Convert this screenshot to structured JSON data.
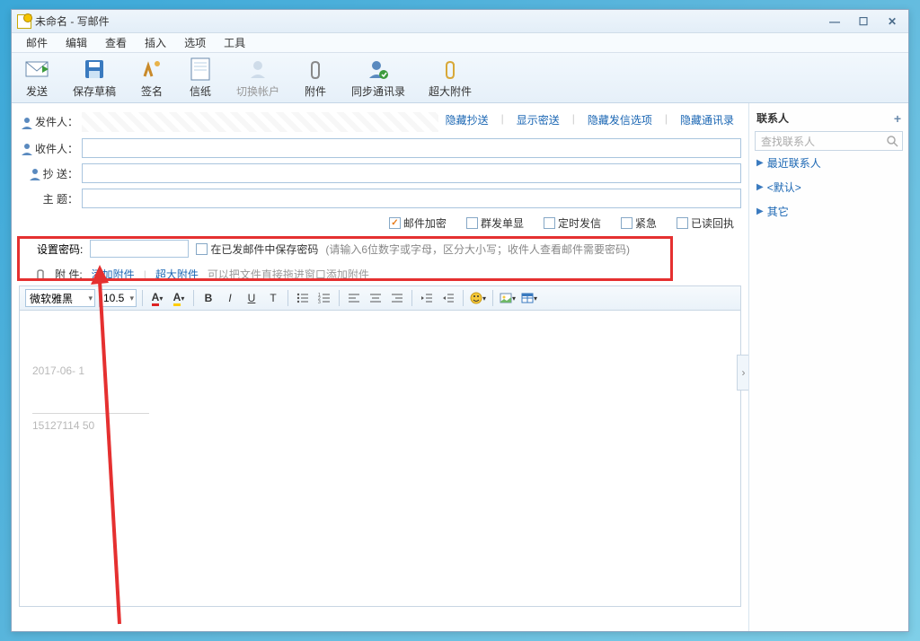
{
  "window": {
    "title": "未命名 - 写邮件"
  },
  "menu": {
    "items": [
      "邮件",
      "编辑",
      "查看",
      "插入",
      "选项",
      "工具"
    ]
  },
  "toolbar": {
    "send": "发送",
    "save_draft": "保存草稿",
    "signature": "签名",
    "letter_paper": "信纸",
    "switch_account": "切换帐户",
    "attachment": "附件",
    "sync_contacts": "同步通讯录",
    "big_attachment": "超大附件"
  },
  "options_links": {
    "hide_cc": "隐藏抄送",
    "show_bcc": "显示密送",
    "hide_send_options": "隐藏发信选项",
    "hide_contacts": "隐藏通讯录"
  },
  "fields": {
    "sender_label": "发件人：",
    "to_label": "收件人：",
    "cc_label": "抄 送：",
    "subject_label": "主 题："
  },
  "send_options": {
    "encrypt": "邮件加密",
    "mass_separate": "群发单显",
    "scheduled": "定时发信",
    "urgent": "紧急",
    "read_receipt": "已读回执"
  },
  "password": {
    "label": "设置密码:",
    "save_chk": "在已发邮件中保存密码",
    "hint": "(请输入6位数字或字母，区分大小写；收件人查看邮件需要密码)"
  },
  "attach": {
    "label": "附 件:",
    "add": "添加附件",
    "big": "超大附件",
    "hint": "可以把文件直接拖进窗口添加附件"
  },
  "format": {
    "font": "微软雅黑",
    "size": "10.5"
  },
  "editor": {
    "date": "2017-06-  1",
    "phone": "15127114  50"
  },
  "sidebar": {
    "title": "联系人",
    "search_placeholder": "查找联系人",
    "groups": [
      "最近联系人",
      "<默认>",
      "其它"
    ]
  }
}
